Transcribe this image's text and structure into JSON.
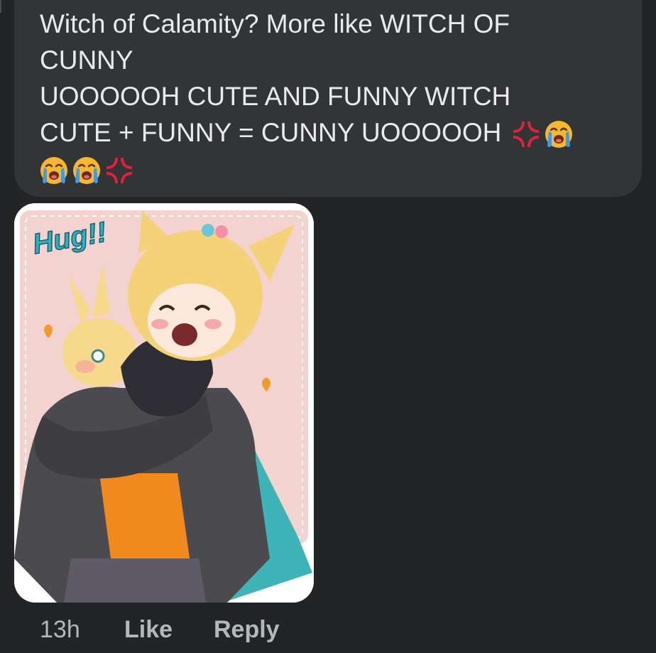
{
  "comment": {
    "lines": [
      "Witch of Calamity? More like WITCH OF",
      "CUNNY",
      "UOOOOOH CUTE AND FUNNY WITCH",
      "CUTE + FUNNY = CUNNY UOOOOOH"
    ],
    "line4_emojis": [
      "anger-symbol",
      "loudly-crying-face"
    ],
    "line5_emojis": [
      "loudly-crying-face",
      "loudly-crying-face",
      "anger-symbol"
    ],
    "image": {
      "title_text": "Hug!!",
      "icon": "anime-witch-hugging-plush-illustration"
    }
  },
  "meta": {
    "time": "13h",
    "like_label": "Like",
    "reply_label": "Reply"
  },
  "colors": {
    "background": "#232426",
    "bubble": "#333436",
    "text": "#e9eaee",
    "meta_text": "#b5b7bb",
    "anger_red": "#e0213b",
    "cry_yellow": "#f7b733",
    "tear_blue": "#3a9be8"
  }
}
